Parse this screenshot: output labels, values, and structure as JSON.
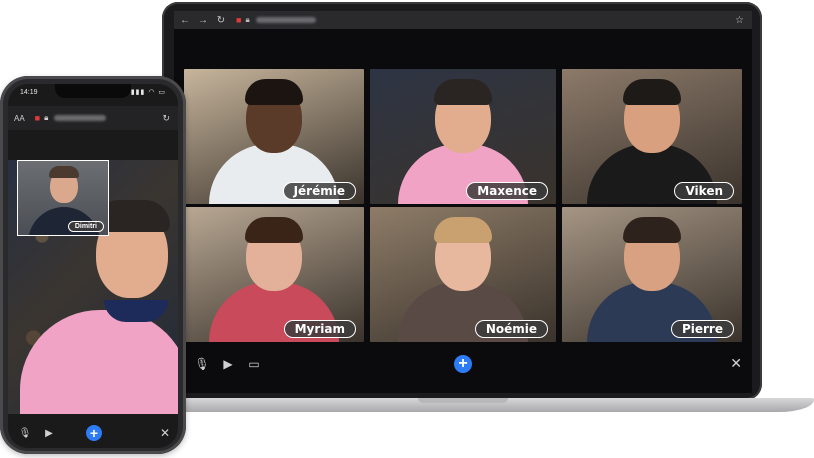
{
  "laptop": {
    "browser": {
      "back_icon": "arrow-left-icon",
      "forward_icon": "arrow-right-icon",
      "reload_icon": "reload-icon",
      "camera_icon": "video-camera-icon",
      "lock_icon": "lock-icon",
      "bookmark_icon": "star-icon"
    },
    "participants": [
      {
        "name": "Jérémie",
        "bg": "#c7b59c",
        "skin": "#5a3a28",
        "hair": "#1c1410",
        "shirt": "#e9ecef"
      },
      {
        "name": "Maxence",
        "bg": "#2e3444",
        "skin": "#e2ad8f",
        "hair": "#2a2522",
        "shirt": "#f0a3c4"
      },
      {
        "name": "Viken",
        "bg": "#8c7a6a",
        "skin": "#d9a07f",
        "hair": "#1e1a18",
        "shirt": "#1a1a1a"
      },
      {
        "name": "Myriam",
        "bg": "#b9a894",
        "skin": "#e3b19a",
        "hair": "#3a2418",
        "shirt": "#c94a5a"
      },
      {
        "name": "Noémie",
        "bg": "#8e7c68",
        "skin": "#e7b89e",
        "hair": "#c9a070",
        "shirt": "#5a4a46"
      },
      {
        "name": "Pierre",
        "bg": "#a59584",
        "skin": "#d8a181",
        "hair": "#2e221c",
        "shirt": "#2c3a56"
      }
    ],
    "toolbar": {
      "mic_icon": "microphone-icon",
      "camera_icon": "video-camera-icon",
      "screen_icon": "screen-share-icon",
      "add_icon": "plus-icon",
      "close_icon": "close-icon",
      "accent": "#2d7cf6"
    }
  },
  "phone": {
    "status": {
      "time": "14:19"
    },
    "address_bar": {
      "text_size": "AA"
    },
    "self_view": {
      "name": "Dimitri"
    },
    "toolbar": {
      "mic_icon": "microphone-icon",
      "camera_icon": "video-camera-icon",
      "add_icon": "plus-icon",
      "close_icon": "close-icon"
    }
  }
}
